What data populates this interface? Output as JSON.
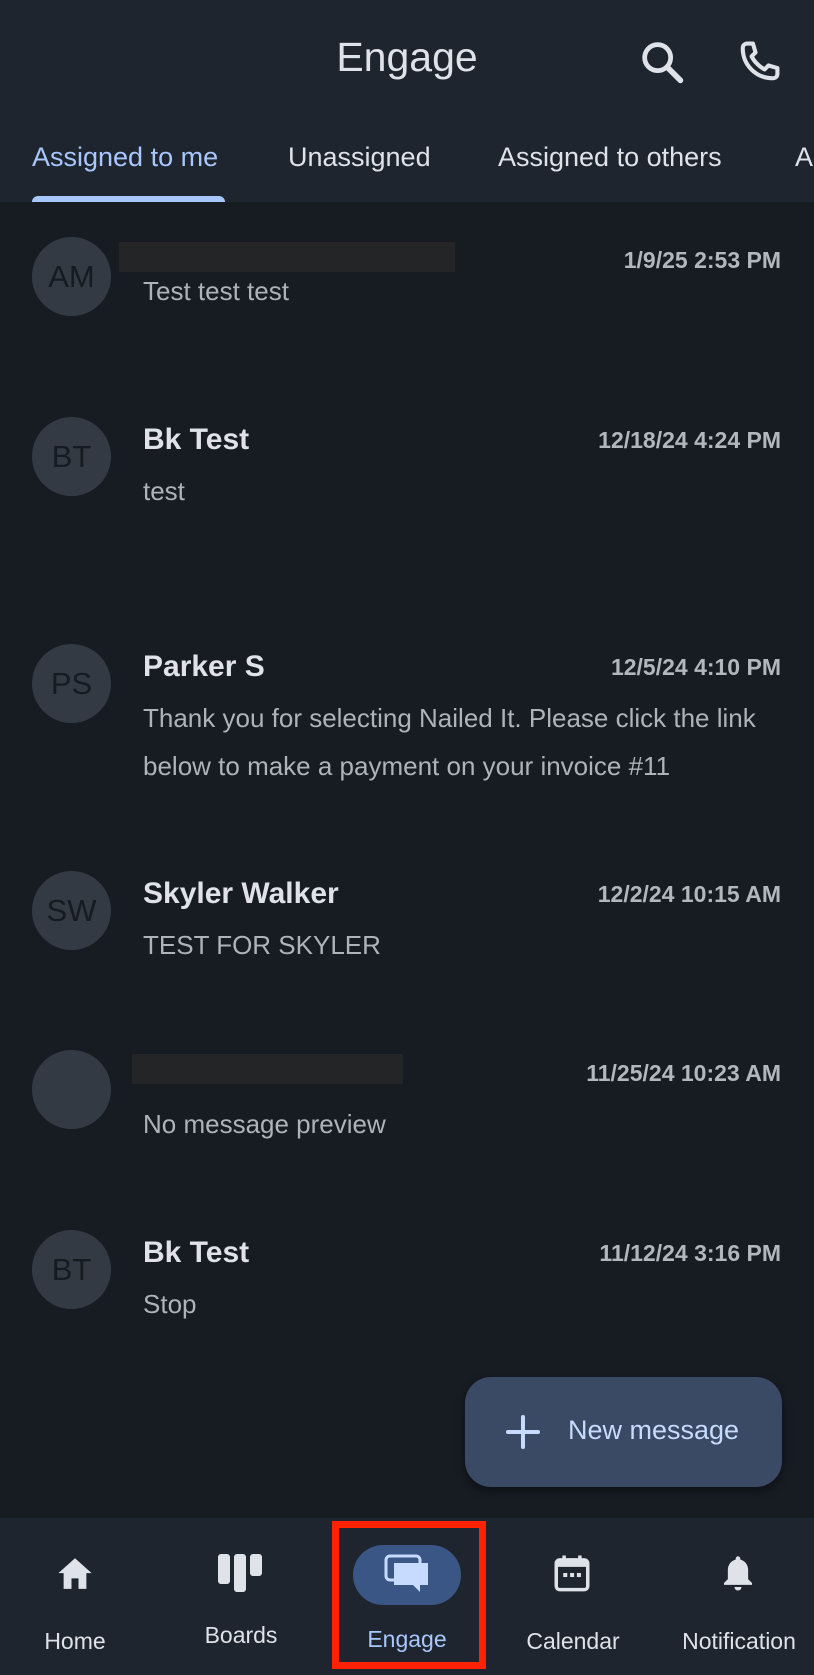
{
  "header": {
    "title": "Engage",
    "icons": [
      "search-icon",
      "phone-icon"
    ]
  },
  "tabs": [
    {
      "label": "Assigned to me",
      "active": true
    },
    {
      "label": "Unassigned",
      "active": false
    },
    {
      "label": "Assigned to others",
      "active": false
    },
    {
      "label": "A",
      "active": false
    }
  ],
  "conversations": [
    {
      "initials": "AM",
      "name": "",
      "time": "1/9/25 2:53 PM",
      "preview": "Test test test",
      "name_redacted": true
    },
    {
      "initials": "BT",
      "name": "Bk Test",
      "time": "12/18/24 4:24 PM",
      "preview": "test"
    },
    {
      "initials": "PS",
      "name": "Parker S",
      "time": "12/5/24 4:10 PM",
      "preview": "Thank you for selecting Nailed It. Please click the link below to make a payment on your invoice #11"
    },
    {
      "initials": "SW",
      "name": "Skyler Walker",
      "time": "12/2/24 10:15 AM",
      "preview": "TEST FOR SKYLER"
    },
    {
      "initials": "",
      "name": "",
      "time": "11/25/24 10:23 AM",
      "preview": "No message preview",
      "name_redacted": true
    },
    {
      "initials": "BT",
      "name": "Bk Test",
      "time": "11/12/24 3:16 PM",
      "preview": "Stop"
    }
  ],
  "fab": {
    "label": "New message",
    "icon": "plus-icon"
  },
  "bottom_nav": [
    {
      "label": "Home",
      "icon": "home-icon"
    },
    {
      "label": "Boards",
      "icon": "boards-icon"
    },
    {
      "label": "Engage",
      "icon": "chat-bubbles-icon",
      "active": true
    },
    {
      "label": "Calendar",
      "icon": "calendar-icon"
    },
    {
      "label": "Notification",
      "icon": "bell-icon"
    }
  ],
  "colors": {
    "background": "#171c23",
    "header": "#1e252e",
    "accent": "#a9c7ff",
    "highlight_box": "#ff2200"
  }
}
